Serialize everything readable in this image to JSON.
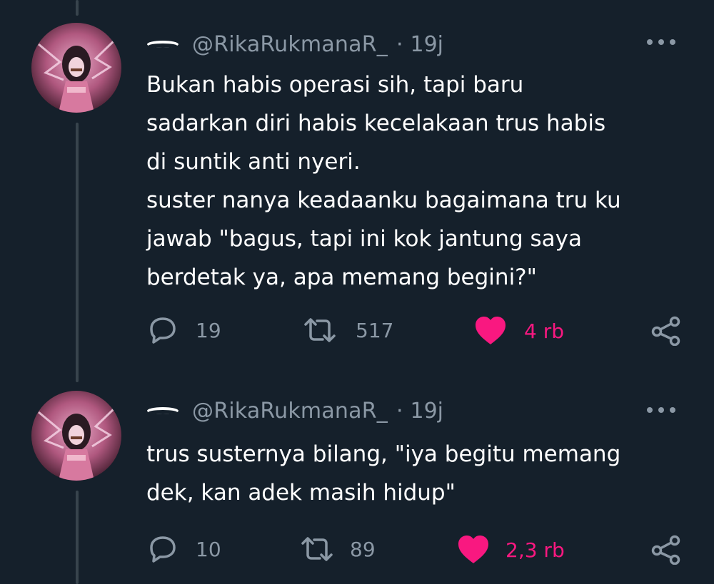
{
  "tweets": [
    {
      "handle": "@RikaRukmanaR_",
      "separator": "·",
      "time": "19j",
      "text": "Bukan habis operasi sih, tapi baru\nsadarkan diri habis kecelakaan trus habis\ndi suntik anti nyeri.\nsuster nanya keadaanku bagaimana tru ku\njawab \"bagus, tapi ini kok jantung saya\nberdetak ya, apa memang begini?\"",
      "replies": "19",
      "retweets": "517",
      "likes": "4 rb"
    },
    {
      "handle": "@RikaRukmanaR_",
      "separator": "·",
      "time": "19j",
      "text": "trus susternya bilang, \"iya begitu memang\ndek, kan adek masih hidup\"",
      "replies": "10",
      "retweets": "89",
      "likes": "2,3 rb"
    }
  ],
  "icons": {
    "reply": "reply-icon",
    "retweet": "retweet-icon",
    "like": "heart-icon",
    "share": "share-icon",
    "more": "more-icon"
  },
  "colors": {
    "background": "#15202b",
    "secondary_text": "#8b98a5",
    "like": "#f91880",
    "thread_line": "#38444d"
  }
}
